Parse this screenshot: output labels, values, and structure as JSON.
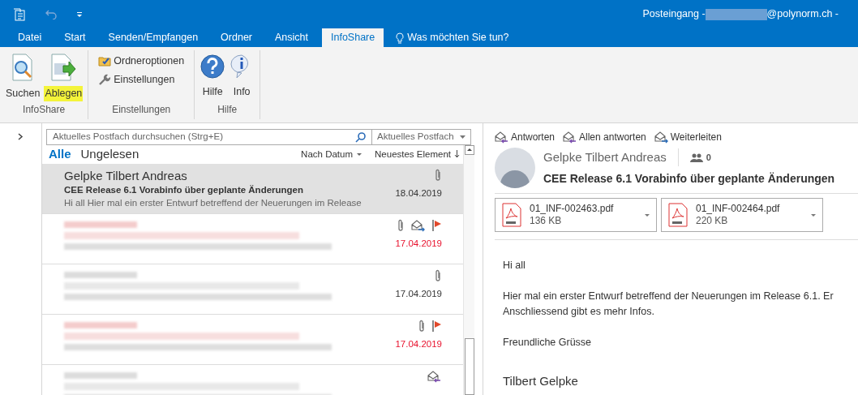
{
  "window": {
    "title_prefix": "Posteingang - ",
    "title_suffix": "@polynorm.ch -"
  },
  "tabs": [
    {
      "label": "Datei",
      "selected": false
    },
    {
      "label": "Start",
      "selected": false
    },
    {
      "label": "Senden/Empfangen",
      "selected": false
    },
    {
      "label": "Ordner",
      "selected": false
    },
    {
      "label": "Ansicht",
      "selected": false
    },
    {
      "label": "InfoShare",
      "selected": true
    }
  ],
  "tell_me": "Was möchten Sie tun?",
  "ribbon": [
    {
      "label": "InfoShare",
      "items": [
        {
          "kind": "large",
          "label": "Suchen",
          "highlighted": false
        },
        {
          "kind": "large",
          "label": "Ablegen",
          "highlighted": true
        }
      ]
    },
    {
      "label": "Einstellungen",
      "items": [
        {
          "kind": "small",
          "label": "Ordneroptionen",
          "highlighted": false
        },
        {
          "kind": "small",
          "label": "Einstellungen",
          "highlighted": false
        }
      ]
    },
    {
      "label": "Hilfe",
      "items": [
        {
          "kind": "large",
          "label": "Hilfe",
          "highlighted": false
        },
        {
          "kind": "large",
          "label": "Info",
          "highlighted": false
        }
      ]
    }
  ],
  "search": {
    "placeholder": "Aktuelles Postfach durchsuchen (Strg+E)",
    "scope": "Aktuelles Postfach"
  },
  "filters": [
    {
      "label": "Alle",
      "selected": true
    },
    {
      "label": "Ungelesen",
      "selected": false
    }
  ],
  "sort": {
    "by": "Nach Datum",
    "order": "Neuestes Element"
  },
  "messages": [
    {
      "selected": true,
      "sender": "Gelpke Tilbert Andreas",
      "subject": "CEE Release 6.1 Vorabinfo über geplante Änderungen",
      "preview": "Hi all  Hier mal ein erster Entwurf betreffend der Neuerungen im Release",
      "date": "18.04.2019",
      "attachment": true,
      "forwarded": false,
      "replied": false,
      "flagged": false
    },
    {
      "selected": false,
      "date": "17.04.2019",
      "attachment": true,
      "forwarded": true,
      "replied": false,
      "flagged": true
    },
    {
      "selected": false,
      "date": "17.04.2019",
      "attachment": true,
      "forwarded": false,
      "replied": false,
      "flagged": false
    },
    {
      "selected": false,
      "date": "17.04.2019",
      "attachment": true,
      "forwarded": false,
      "replied": false,
      "flagged": true
    },
    {
      "selected": false,
      "attachment": false,
      "forwarded": false,
      "replied": true,
      "flagged": false
    }
  ],
  "reading": {
    "actions": [
      {
        "kind": "reply",
        "label": "Antworten"
      },
      {
        "kind": "reply-all",
        "label": "Allen antworten"
      },
      {
        "kind": "forward",
        "label": "Weiterleiten"
      }
    ],
    "sender": "Gelpke Tilbert Andreas",
    "people_count": "0",
    "subject": "CEE Release 6.1 Vorabinfo über geplante Änderungen",
    "attachments": [
      {
        "name": "01_INF-002463.pdf",
        "size": "136 KB"
      },
      {
        "name": "01_INF-002464.pdf",
        "size": "220 KB"
      }
    ],
    "body": [
      "Hi all",
      "Hier mal ein erster Entwurf betreffend der Neuerungen im Release 6.1.  Er",
      "Anschliessend gibt es mehr Infos.",
      "Freundliche Grüsse"
    ],
    "signature": "Tilbert Gelpke"
  }
}
